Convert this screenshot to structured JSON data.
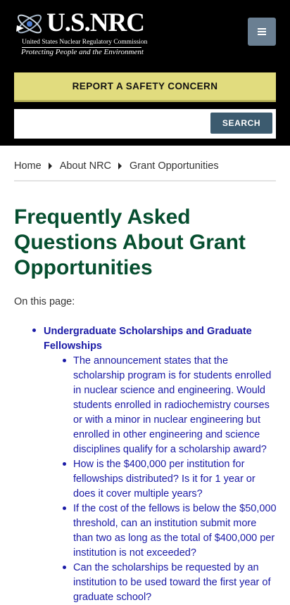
{
  "header": {
    "logo": {
      "name": "U.S.NRC",
      "subtitle": "United States Nuclear Regulatory Commission",
      "tagline": "Protecting People and the Environment"
    },
    "menu_icon": "hamburger-menu-icon",
    "report_label": "REPORT A SAFETY CONCERN",
    "search": {
      "value": "",
      "placeholder": "",
      "button_label": "SEARCH"
    }
  },
  "breadcrumb": {
    "items": [
      "Home",
      "About NRC",
      "Grant Opportunities"
    ]
  },
  "page": {
    "title": "Frequently Asked Questions About Grant Opportunities",
    "on_this_page": "On this page:",
    "toc": {
      "section_label": "Undergraduate Scholarships and Graduate Fellowships",
      "questions": [
        "The announcement states that the scholarship program is for students enrolled in nuclear science and engineering. Would students enrolled in radiochemistry courses or with a minor in nuclear engineering but enrolled in other engineering and science disciplines qualify for a scholarship award?",
        "How is the $400,000 per institution for fellowships distributed? Is it for 1 year or does it cover multiple years?",
        "If the cost of the fellows is below the $50,000 threshold, can an institution submit more than two as long as the total of $400,000 per institution is not exceeded?",
        "Can the scholarships be requested by an institution to be used toward the first year of graduate school?"
      ]
    }
  },
  "colors": {
    "header_bg": "#000000",
    "report_bg": "#e1dc7e",
    "search_button_bg": "#3c5b6f",
    "menu_button_bg": "#6a7f92",
    "title_color": "#064e2f",
    "link_color": "#1a1aa6"
  }
}
